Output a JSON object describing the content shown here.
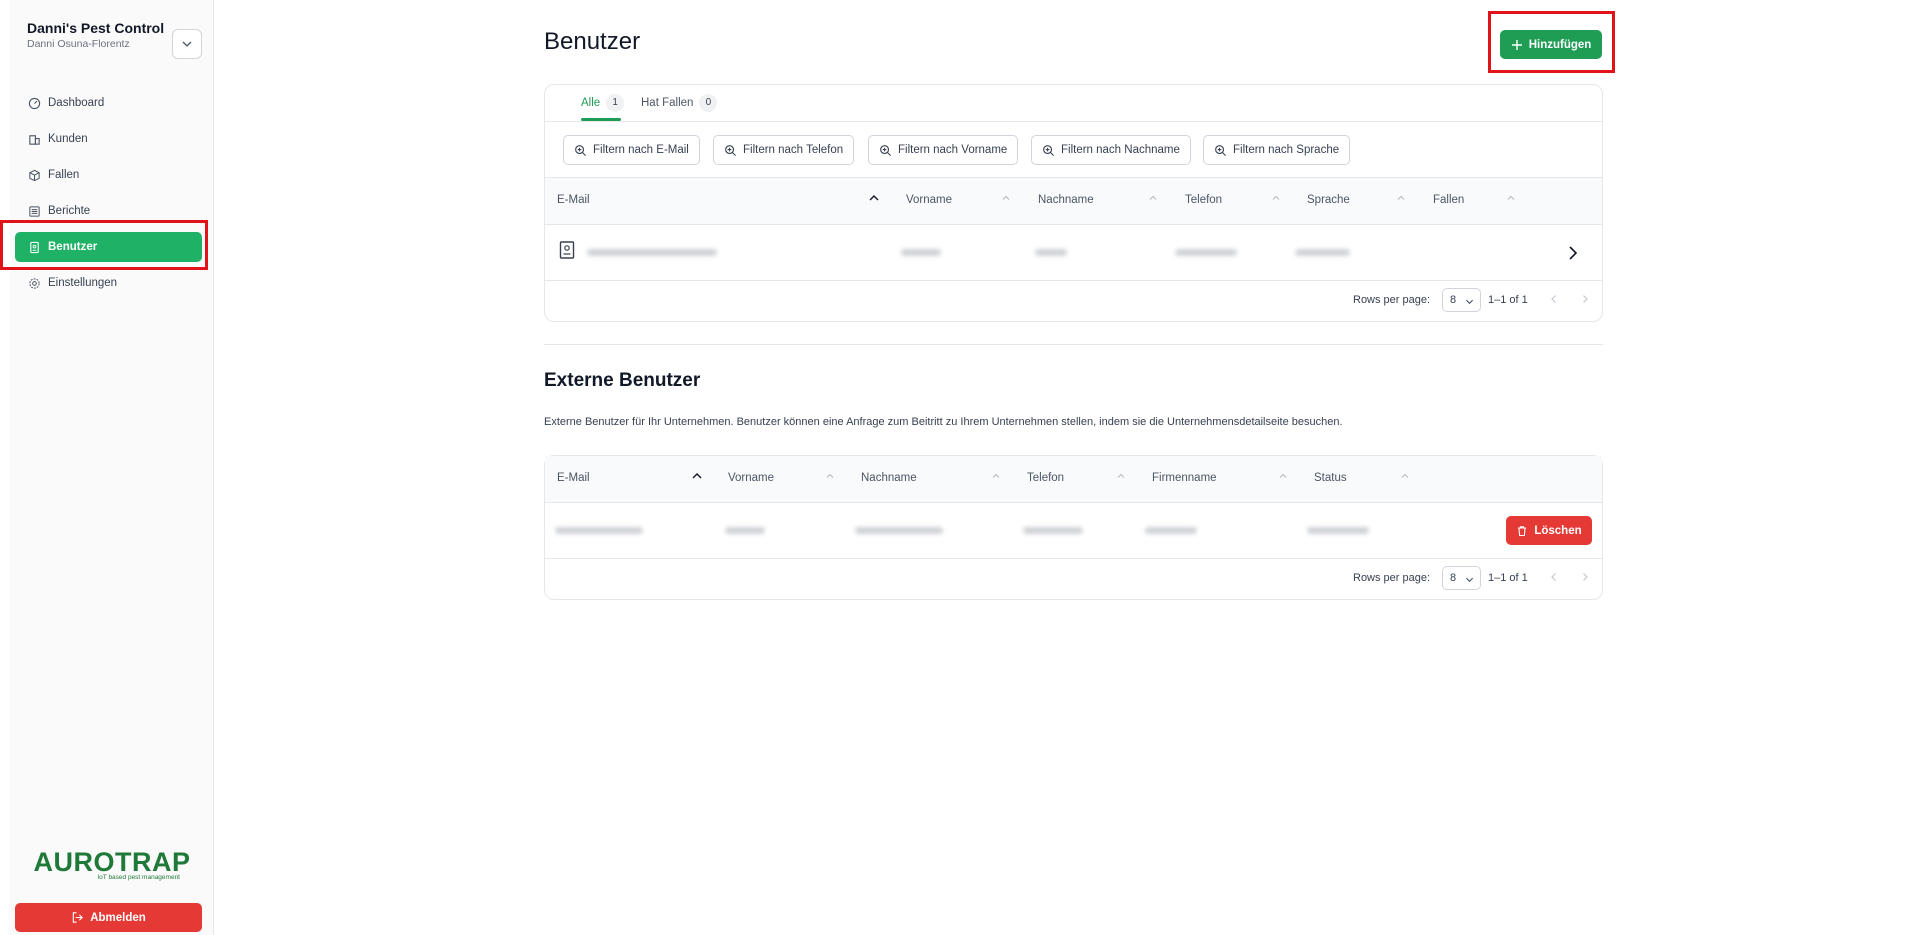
{
  "sidebar": {
    "company_name": "Danni's Pest Control",
    "company_user": "Danni Osuna-Florentz",
    "nav": [
      {
        "label": "Dashboard",
        "icon": "gauge-icon"
      },
      {
        "label": "Kunden",
        "icon": "building-icon"
      },
      {
        "label": "Fallen",
        "icon": "box-icon"
      },
      {
        "label": "Berichte",
        "icon": "list-icon"
      },
      {
        "label": "Benutzer",
        "icon": "badge-icon",
        "active": true
      },
      {
        "label": "Einstellungen",
        "icon": "gear-icon"
      }
    ],
    "logo_main": "AUROTRAP",
    "logo_sub": "IoT based pest management",
    "logout_label": "Abmelden"
  },
  "main": {
    "title": "Benutzer",
    "add_label": "Hinzufügen",
    "tabs": [
      {
        "label": "Alle",
        "count": "1",
        "active": true
      },
      {
        "label": "Hat Fallen",
        "count": "0"
      }
    ],
    "filters": [
      "Filtern nach E-Mail",
      "Filtern nach Telefon",
      "Filtern nach Vorname",
      "Filtern nach Nachname",
      "Filtern nach Sprache"
    ],
    "columns": [
      "E-Mail",
      "Vorname",
      "Nachname",
      "Telefon",
      "Sprache",
      "Fallen"
    ],
    "footer": {
      "rows_label": "Rows per page:",
      "rows_value": "8",
      "range": "1–1 of 1"
    }
  },
  "external": {
    "title": "Externe Benutzer",
    "description": "Externe Benutzer für Ihr Unternehmen. Benutzer können eine Anfrage zum Beitritt zu Ihrem Unternehmen stellen, indem sie die Unternehmensdetailseite besuchen.",
    "columns": [
      "E-Mail",
      "Vorname",
      "Nachname",
      "Telefon",
      "Firmenname",
      "Status"
    ],
    "delete_label": "Löschen",
    "footer": {
      "rows_label": "Rows per page:",
      "rows_value": "8",
      "range": "1–1 of 1"
    }
  },
  "colors": {
    "accent": "#1f9d55",
    "danger": "#e53935",
    "highlight": "#e0131b"
  }
}
